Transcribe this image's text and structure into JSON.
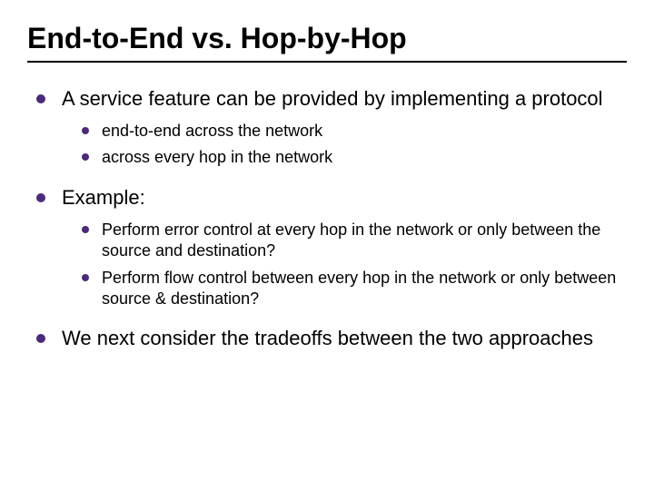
{
  "title": "End-to-End vs. Hop-by-Hop",
  "bullets": [
    {
      "text": "A service feature can be provided by implementing a protocol",
      "sub": [
        {
          "text": "end-to-end across the network"
        },
        {
          "text": "across every hop in the network"
        }
      ]
    },
    {
      "text": "Example:",
      "sub": [
        {
          "text": "Perform error control at every hop in the network or only between the source and destination?"
        },
        {
          "text": "Perform flow control between every hop in the network or only between source & destination?"
        }
      ]
    },
    {
      "text": "We next consider the tradeoffs between the two approaches",
      "sub": []
    }
  ]
}
